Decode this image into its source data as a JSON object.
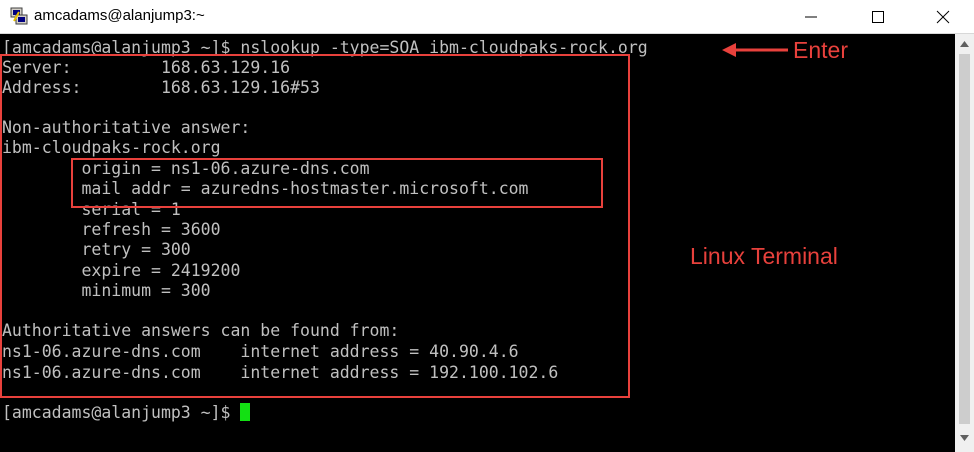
{
  "window": {
    "title": "amcadams@alanjump3:~",
    "icon": "putty-icon",
    "controls": [
      "minimize-icon",
      "maximize-icon",
      "close-icon"
    ]
  },
  "terminal": {
    "lines": [
      "[amcadams@alanjump3 ~]$ nslookup -type=SOA ibm-cloudpaks-rock.org",
      "Server:         168.63.129.16",
      "Address:        168.63.129.16#53",
      "",
      "Non-authoritative answer:",
      "ibm-cloudpaks-rock.org",
      "        origin = ns1-06.azure-dns.com",
      "        mail addr = azuredns-hostmaster.microsoft.com",
      "        serial = 1",
      "        refresh = 3600",
      "        retry = 300",
      "        expire = 2419200",
      "        minimum = 300",
      "",
      "Authoritative answers can be found from:",
      "ns1-06.azure-dns.com    internet address = 40.90.4.6",
      "ns1-06.azure-dns.com    internet address = 192.100.102.6",
      "",
      "[amcadams@alanjump3 ~]$ "
    ],
    "text_color": "#c0c0c0",
    "cursor_color": "#13e013"
  },
  "annotations": {
    "enter_label": "Enter",
    "terminal_label": "Linux Terminal",
    "color": "#e8413c"
  }
}
